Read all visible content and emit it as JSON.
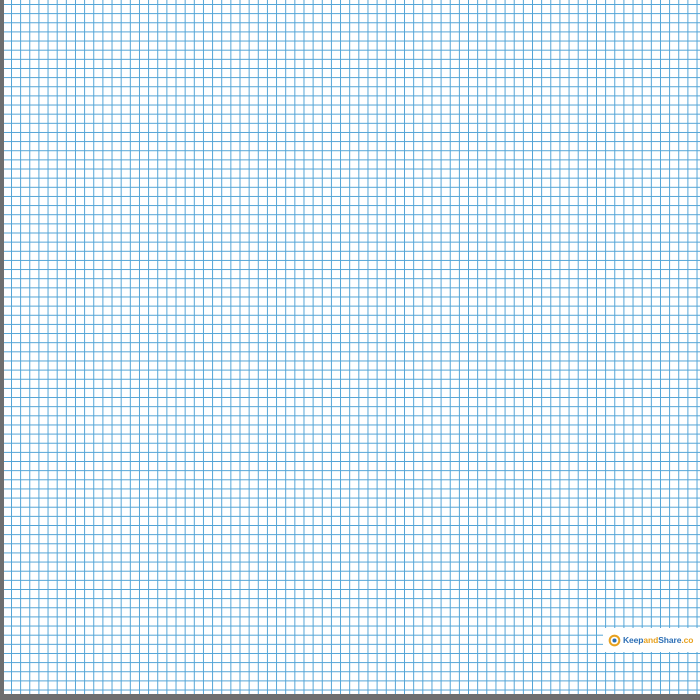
{
  "logo": {
    "part_keep": "Keep",
    "part_and": "and",
    "part_share": "Share",
    "part_tld": ".co",
    "brand_blue": "#2c6fb6",
    "brand_orange": "#e8a21f"
  },
  "grid": {
    "line_color": "#4fa3d6",
    "paper_color": "#ffffff",
    "frame_color": "#6e6e6e"
  }
}
